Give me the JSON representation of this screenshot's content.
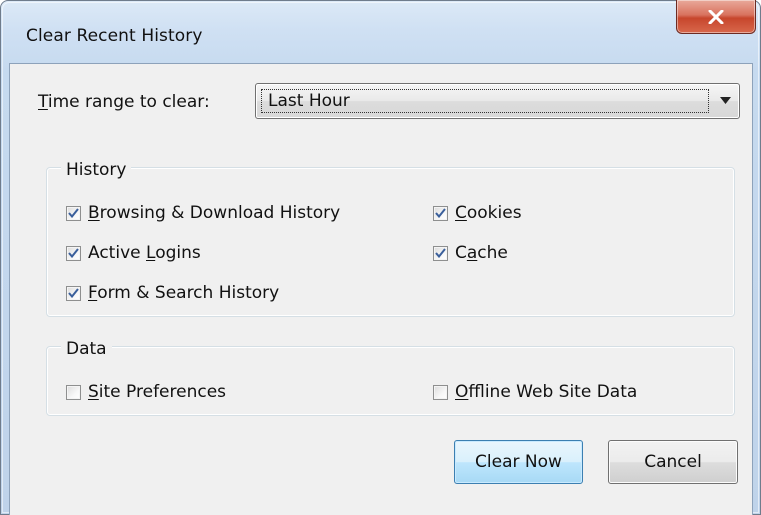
{
  "window": {
    "title": "Clear Recent History",
    "close_icon": "close-x-icon"
  },
  "time_range": {
    "label_underlined": "T",
    "label_rest": "ime range to clear:",
    "selected_value": "Last Hour",
    "dropdown_icon": "chevron-down-icon"
  },
  "history": {
    "legend": "History",
    "items": [
      {
        "u": "B",
        "rest": "rowsing & Download History",
        "checked": true
      },
      {
        "pre": "Active ",
        "u": "L",
        "rest": "ogins",
        "checked": true
      },
      {
        "u": "F",
        "rest": "orm & Search History",
        "checked": true
      },
      {
        "u": "C",
        "rest": "ookies",
        "checked": true
      },
      {
        "pre": "C",
        "u": "a",
        "rest": "che",
        "checked": true
      }
    ]
  },
  "data": {
    "legend": "Data",
    "items": [
      {
        "u": "S",
        "rest": "ite Preferences",
        "checked": false
      },
      {
        "u": "O",
        "rest": "ffline Web Site Data",
        "checked": false
      }
    ]
  },
  "buttons": {
    "clear_now": "Clear Now",
    "cancel": "Cancel"
  },
  "colors": {
    "close_button": "#c7462c",
    "default_button_border": "#3c7fb1",
    "check_mark": "#3a5f9b"
  }
}
